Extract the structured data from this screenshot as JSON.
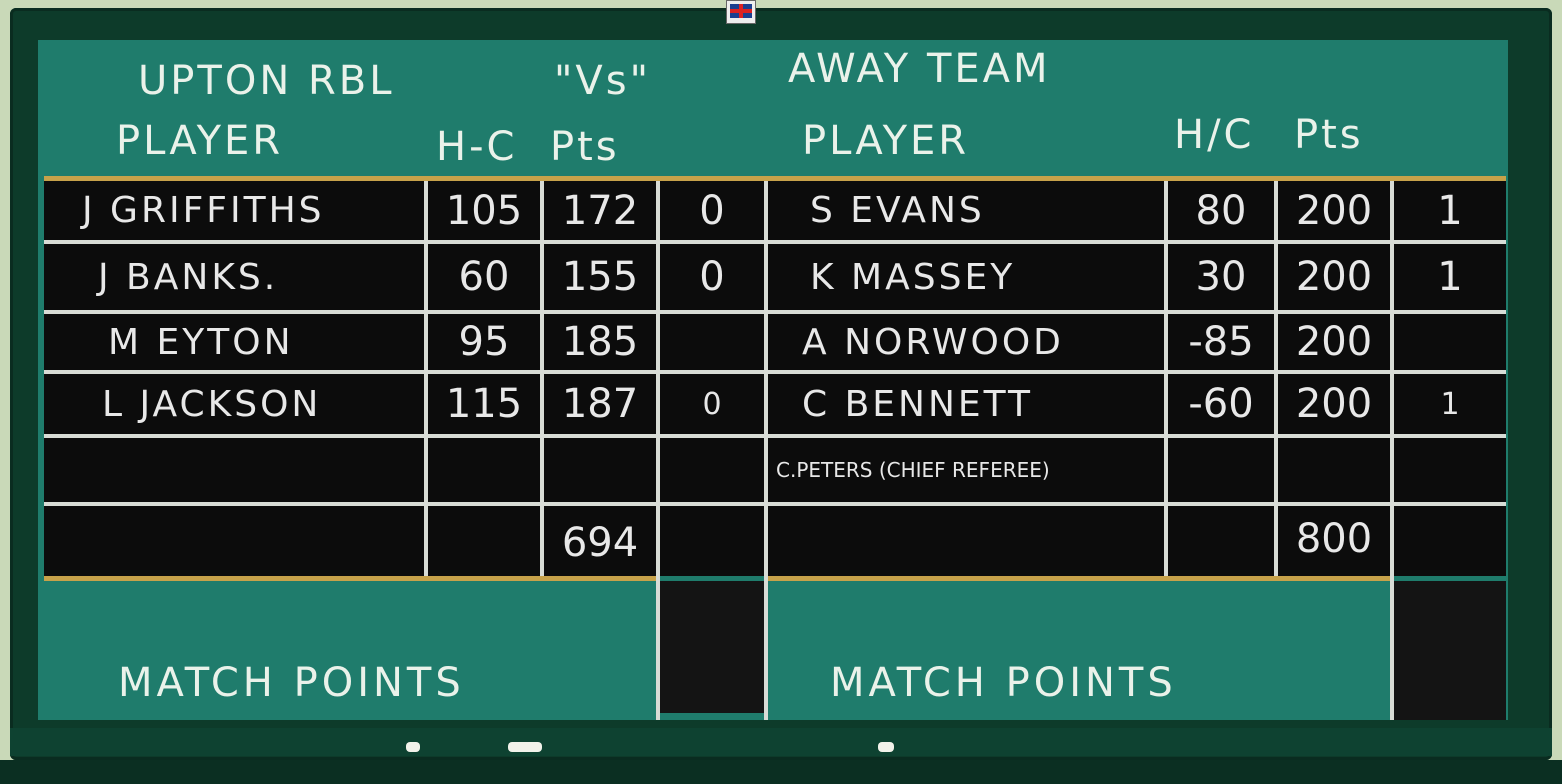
{
  "header": {
    "home_team": "UPTON RBL",
    "vs": "\"Vs\"",
    "away_team": "AWAY TEAM",
    "home_player_label": "PLAYER",
    "home_hc_label": "H-C",
    "home_pts_label": "Pts",
    "away_player_label": "PLAYER",
    "away_hc_label": "H/C",
    "away_pts_label": "Pts"
  },
  "rows": [
    {
      "home_name": "J GRIFFITHS",
      "home_hc": "105",
      "home_pts": "172",
      "home_mp": "0",
      "away_name": "S EVANS",
      "away_hc": "80",
      "away_pts": "200",
      "away_mp": "1"
    },
    {
      "home_name": "J BANKS.",
      "home_hc": "60",
      "home_pts": "155",
      "home_mp": "0",
      "away_name": "K MASSEY",
      "away_hc": "30",
      "away_pts": "200",
      "away_mp": "1"
    },
    {
      "home_name": "M EYTON",
      "home_hc": "95",
      "home_pts": "185",
      "home_mp": "",
      "away_name": "A NORWOOD",
      "away_hc": "-85",
      "away_pts": "200",
      "away_mp": ""
    },
    {
      "home_name": "L JACKSON",
      "home_hc": "115",
      "home_pts": "187",
      "home_mp": "0",
      "away_name": "C BENNETT",
      "away_hc": "-60",
      "away_pts": "200",
      "away_mp": "1"
    },
    {
      "home_name": "",
      "home_hc": "",
      "home_pts": "",
      "home_mp": "",
      "away_name": "C.PETERS (CHIEF REFEREE)",
      "away_hc": "",
      "away_pts": "",
      "away_mp": ""
    }
  ],
  "totals": {
    "home_pts": "694",
    "away_pts": "800"
  },
  "footer": {
    "home_label": "MATCH POINTS",
    "away_label": "MATCH POINTS"
  }
}
